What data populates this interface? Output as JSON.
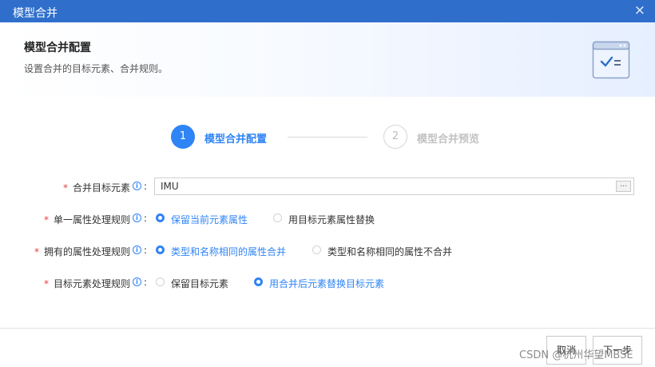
{
  "window": {
    "title": "模型合并",
    "close_icon": "×"
  },
  "banner": {
    "heading": "模型合并配置",
    "subtitle": "设置合并的目标元素、合并规则。",
    "illustration_icon": "checklist-window-icon"
  },
  "steps": [
    {
      "number": "1",
      "label": "模型合并配置",
      "active": true
    },
    {
      "number": "2",
      "label": "模型合并预览",
      "active": false
    }
  ],
  "form": {
    "required_mark": "*",
    "colon": ":",
    "target_element": {
      "label": "合并目标元素",
      "value": "IMU",
      "browse_label": "..."
    },
    "single_attr_rule": {
      "label": "单一属性处理规则",
      "options": [
        {
          "text": "保留当前元素属性",
          "selected": true
        },
        {
          "text": "用目标元素属性替换",
          "selected": false
        }
      ]
    },
    "owned_attr_rule": {
      "label": "拥有的属性处理规则",
      "options": [
        {
          "text": "类型和名称相同的属性合并",
          "selected": true
        },
        {
          "text": "类型和名称相同的属性不合并",
          "selected": false
        }
      ]
    },
    "target_element_rule": {
      "label": "目标元素处理规则",
      "options": [
        {
          "text": "保留目标元素",
          "selected": false
        },
        {
          "text": "用合并后元素替换目标元素",
          "selected": true
        }
      ]
    }
  },
  "footer": {
    "cancel_label": "取消",
    "next_label": "下一步"
  },
  "watermark": "CSDN @杭州华望MBSE",
  "colors": {
    "title_bar": "#2f6fcb",
    "accent": "#2f84f6",
    "required": "#e0443c"
  }
}
